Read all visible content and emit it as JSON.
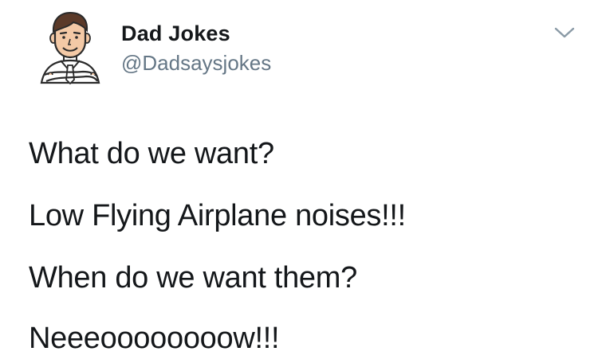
{
  "tweet": {
    "author": {
      "display_name": "Dad Jokes",
      "handle": "@Dadsaysjokes",
      "avatar_icon": "cartoon-dad-avatar-icon"
    },
    "menu_icon": "chevron-down-icon",
    "lines": [
      "What do we want?",
      "Low Flying Airplane noises!!!",
      "When do we want them?",
      "Neeeoooooooow!!!"
    ]
  },
  "colors": {
    "text": "#14171a",
    "secondary_text": "#657786",
    "caret": "#8a9aa6",
    "background": "#ffffff"
  }
}
